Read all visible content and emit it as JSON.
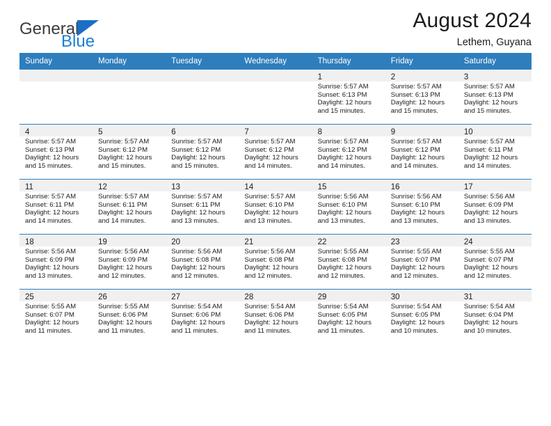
{
  "brand": {
    "name_top": "General",
    "name_bottom": "Blue",
    "triangle_color": "#1b6ec2",
    "blue_color": "#1b7fd4"
  },
  "header": {
    "title": "August 2024",
    "subtitle": "Lethem, Guyana"
  },
  "theme": {
    "header_row_bg": "#2e7ebd",
    "daynum_bg": "#f0f0f0",
    "grid_line": "#2e7ebd"
  },
  "labels": {
    "sunrise_prefix": "Sunrise: ",
    "sunset_prefix": "Sunset: ",
    "daylight_prefix": "Daylight: "
  },
  "weekdays": [
    "Sunday",
    "Monday",
    "Tuesday",
    "Wednesday",
    "Thursday",
    "Friday",
    "Saturday"
  ],
  "weeks": [
    [
      {
        "empty": true
      },
      {
        "empty": true
      },
      {
        "empty": true
      },
      {
        "empty": true
      },
      {
        "day": "1",
        "sunrise": "Sunrise: 5:57 AM",
        "sunset": "Sunset: 6:13 PM",
        "daylight1": "Daylight: 12 hours",
        "daylight2": "and 15 minutes."
      },
      {
        "day": "2",
        "sunrise": "Sunrise: 5:57 AM",
        "sunset": "Sunset: 6:13 PM",
        "daylight1": "Daylight: 12 hours",
        "daylight2": "and 15 minutes."
      },
      {
        "day": "3",
        "sunrise": "Sunrise: 5:57 AM",
        "sunset": "Sunset: 6:13 PM",
        "daylight1": "Daylight: 12 hours",
        "daylight2": "and 15 minutes."
      }
    ],
    [
      {
        "day": "4",
        "sunrise": "Sunrise: 5:57 AM",
        "sunset": "Sunset: 6:13 PM",
        "daylight1": "Daylight: 12 hours",
        "daylight2": "and 15 minutes."
      },
      {
        "day": "5",
        "sunrise": "Sunrise: 5:57 AM",
        "sunset": "Sunset: 6:12 PM",
        "daylight1": "Daylight: 12 hours",
        "daylight2": "and 15 minutes."
      },
      {
        "day": "6",
        "sunrise": "Sunrise: 5:57 AM",
        "sunset": "Sunset: 6:12 PM",
        "daylight1": "Daylight: 12 hours",
        "daylight2": "and 15 minutes."
      },
      {
        "day": "7",
        "sunrise": "Sunrise: 5:57 AM",
        "sunset": "Sunset: 6:12 PM",
        "daylight1": "Daylight: 12 hours",
        "daylight2": "and 14 minutes."
      },
      {
        "day": "8",
        "sunrise": "Sunrise: 5:57 AM",
        "sunset": "Sunset: 6:12 PM",
        "daylight1": "Daylight: 12 hours",
        "daylight2": "and 14 minutes."
      },
      {
        "day": "9",
        "sunrise": "Sunrise: 5:57 AM",
        "sunset": "Sunset: 6:12 PM",
        "daylight1": "Daylight: 12 hours",
        "daylight2": "and 14 minutes."
      },
      {
        "day": "10",
        "sunrise": "Sunrise: 5:57 AM",
        "sunset": "Sunset: 6:11 PM",
        "daylight1": "Daylight: 12 hours",
        "daylight2": "and 14 minutes."
      }
    ],
    [
      {
        "day": "11",
        "sunrise": "Sunrise: 5:57 AM",
        "sunset": "Sunset: 6:11 PM",
        "daylight1": "Daylight: 12 hours",
        "daylight2": "and 14 minutes."
      },
      {
        "day": "12",
        "sunrise": "Sunrise: 5:57 AM",
        "sunset": "Sunset: 6:11 PM",
        "daylight1": "Daylight: 12 hours",
        "daylight2": "and 14 minutes."
      },
      {
        "day": "13",
        "sunrise": "Sunrise: 5:57 AM",
        "sunset": "Sunset: 6:11 PM",
        "daylight1": "Daylight: 12 hours",
        "daylight2": "and 13 minutes."
      },
      {
        "day": "14",
        "sunrise": "Sunrise: 5:57 AM",
        "sunset": "Sunset: 6:10 PM",
        "daylight1": "Daylight: 12 hours",
        "daylight2": "and 13 minutes."
      },
      {
        "day": "15",
        "sunrise": "Sunrise: 5:56 AM",
        "sunset": "Sunset: 6:10 PM",
        "daylight1": "Daylight: 12 hours",
        "daylight2": "and 13 minutes."
      },
      {
        "day": "16",
        "sunrise": "Sunrise: 5:56 AM",
        "sunset": "Sunset: 6:10 PM",
        "daylight1": "Daylight: 12 hours",
        "daylight2": "and 13 minutes."
      },
      {
        "day": "17",
        "sunrise": "Sunrise: 5:56 AM",
        "sunset": "Sunset: 6:09 PM",
        "daylight1": "Daylight: 12 hours",
        "daylight2": "and 13 minutes."
      }
    ],
    [
      {
        "day": "18",
        "sunrise": "Sunrise: 5:56 AM",
        "sunset": "Sunset: 6:09 PM",
        "daylight1": "Daylight: 12 hours",
        "daylight2": "and 13 minutes."
      },
      {
        "day": "19",
        "sunrise": "Sunrise: 5:56 AM",
        "sunset": "Sunset: 6:09 PM",
        "daylight1": "Daylight: 12 hours",
        "daylight2": "and 12 minutes."
      },
      {
        "day": "20",
        "sunrise": "Sunrise: 5:56 AM",
        "sunset": "Sunset: 6:08 PM",
        "daylight1": "Daylight: 12 hours",
        "daylight2": "and 12 minutes."
      },
      {
        "day": "21",
        "sunrise": "Sunrise: 5:56 AM",
        "sunset": "Sunset: 6:08 PM",
        "daylight1": "Daylight: 12 hours",
        "daylight2": "and 12 minutes."
      },
      {
        "day": "22",
        "sunrise": "Sunrise: 5:55 AM",
        "sunset": "Sunset: 6:08 PM",
        "daylight1": "Daylight: 12 hours",
        "daylight2": "and 12 minutes."
      },
      {
        "day": "23",
        "sunrise": "Sunrise: 5:55 AM",
        "sunset": "Sunset: 6:07 PM",
        "daylight1": "Daylight: 12 hours",
        "daylight2": "and 12 minutes."
      },
      {
        "day": "24",
        "sunrise": "Sunrise: 5:55 AM",
        "sunset": "Sunset: 6:07 PM",
        "daylight1": "Daylight: 12 hours",
        "daylight2": "and 12 minutes."
      }
    ],
    [
      {
        "day": "25",
        "sunrise": "Sunrise: 5:55 AM",
        "sunset": "Sunset: 6:07 PM",
        "daylight1": "Daylight: 12 hours",
        "daylight2": "and 11 minutes."
      },
      {
        "day": "26",
        "sunrise": "Sunrise: 5:55 AM",
        "sunset": "Sunset: 6:06 PM",
        "daylight1": "Daylight: 12 hours",
        "daylight2": "and 11 minutes."
      },
      {
        "day": "27",
        "sunrise": "Sunrise: 5:54 AM",
        "sunset": "Sunset: 6:06 PM",
        "daylight1": "Daylight: 12 hours",
        "daylight2": "and 11 minutes."
      },
      {
        "day": "28",
        "sunrise": "Sunrise: 5:54 AM",
        "sunset": "Sunset: 6:06 PM",
        "daylight1": "Daylight: 12 hours",
        "daylight2": "and 11 minutes."
      },
      {
        "day": "29",
        "sunrise": "Sunrise: 5:54 AM",
        "sunset": "Sunset: 6:05 PM",
        "daylight1": "Daylight: 12 hours",
        "daylight2": "and 11 minutes."
      },
      {
        "day": "30",
        "sunrise": "Sunrise: 5:54 AM",
        "sunset": "Sunset: 6:05 PM",
        "daylight1": "Daylight: 12 hours",
        "daylight2": "and 10 minutes."
      },
      {
        "day": "31",
        "sunrise": "Sunrise: 5:54 AM",
        "sunset": "Sunset: 6:04 PM",
        "daylight1": "Daylight: 12 hours",
        "daylight2": "and 10 minutes."
      }
    ]
  ]
}
